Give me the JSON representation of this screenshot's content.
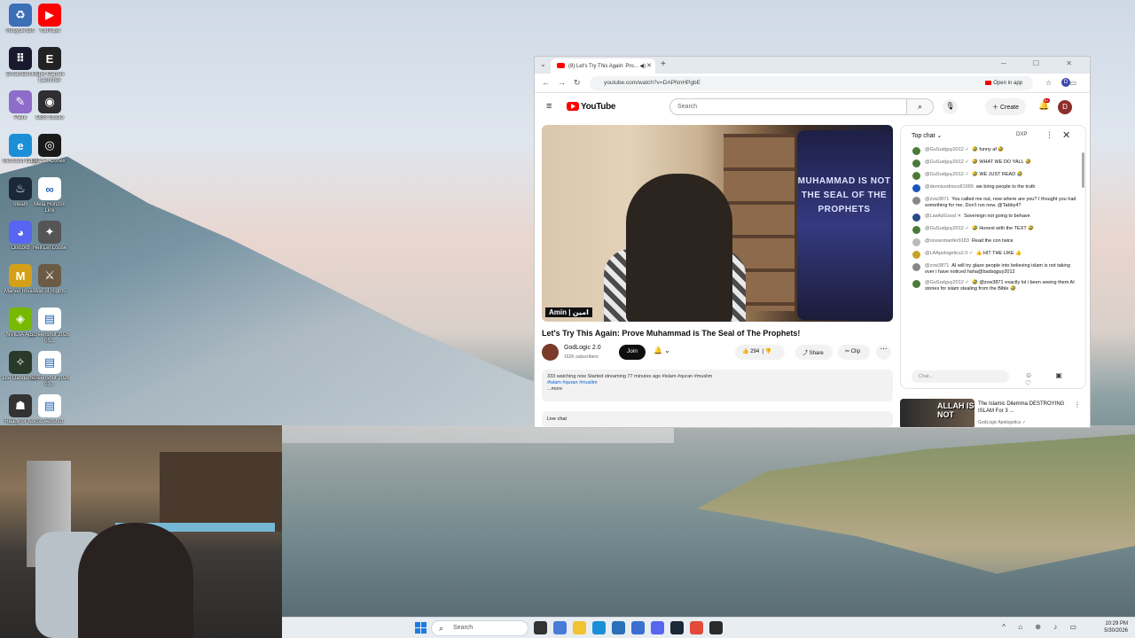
{
  "desktop": {
    "icons": [
      {
        "label": "Recycle Bin",
        "icon": "recycle-bin-icon",
        "color": "#3b6fb6",
        "glyph": "♻"
      },
      {
        "label": "YouTube",
        "icon": "youtube-icon",
        "color": "#ff0000",
        "glyph": "▶"
      },
      {
        "label": "DreamDeck",
        "icon": "dreamdeck-icon",
        "color": "#1a1a2e",
        "glyph": "⠿"
      },
      {
        "label": "Epic Games Launcher",
        "icon": "epic-games-icon",
        "color": "#222222",
        "glyph": "E"
      },
      {
        "label": "Paint",
        "icon": "paint-icon",
        "color": "#8e6cc9",
        "glyph": "✎"
      },
      {
        "label": "OBS Studio",
        "icon": "obs-icon",
        "color": "#302e31",
        "glyph": "◉"
      },
      {
        "label": "Microsoft Edge",
        "icon": "edge-icon",
        "color": "#1a8fd8",
        "glyph": "e"
      },
      {
        "label": "Razer Cortex",
        "icon": "razer-icon",
        "color": "#1a1a1a",
        "glyph": "◎"
      },
      {
        "label": "Steam",
        "icon": "steam-icon",
        "color": "#1b2838",
        "glyph": "♨"
      },
      {
        "label": "Meta Horizon Link",
        "icon": "meta-icon",
        "color": "#ffffff",
        "glyph": "∞"
      },
      {
        "label": "Discord",
        "icon": "discord-icon",
        "color": "#5865f2",
        "glyph": "◕"
      },
      {
        "label": "Hell Let Loose",
        "icon": "hell-let-loose-icon",
        "color": "#555555",
        "glyph": "✦"
      },
      {
        "label": "Marvel Rivals",
        "icon": "marvel-rivals-icon",
        "color": "#d4a017",
        "glyph": "M"
      },
      {
        "label": "War of Rights",
        "icon": "war-of-rights-icon",
        "color": "#6b5b45",
        "glyph": "⚔"
      },
      {
        "label": "NVIDIA App",
        "icon": "nvidia-icon",
        "color": "#76b900",
        "glyph": "◈"
      },
      {
        "label": "Screenshot 2026 05...",
        "icon": "screenshot-file-icon",
        "color": "#ffffff",
        "glyph": "▤"
      },
      {
        "label": "Lite Dangerous",
        "icon": "lite-dangerous-icon",
        "color": "#2a3a2a",
        "glyph": "✧"
      },
      {
        "label": "Screenshot 2026 03...",
        "icon": "screenshot-file-icon",
        "color": "#ffffff",
        "glyph": "▤"
      },
      {
        "label": "Ready or Not",
        "icon": "ready-or-not-icon",
        "color": "#333333",
        "glyph": "☗"
      },
      {
        "label": "Screenshot",
        "icon": "screenshot-file-icon",
        "color": "#ffffff",
        "glyph": "▤"
      }
    ]
  },
  "taskbar": {
    "search_placeholder": "Search",
    "apps": [
      {
        "name": "task-view",
        "color": "#333333"
      },
      {
        "name": "copilot",
        "color": "#4a7bd8"
      },
      {
        "name": "file-explorer",
        "color": "#f2c230"
      },
      {
        "name": "edge",
        "color": "#1a8fd8"
      },
      {
        "name": "store",
        "color": "#2a6fb8"
      },
      {
        "name": "draw",
        "color": "#3a6fd0"
      },
      {
        "name": "discord",
        "color": "#5865f2"
      },
      {
        "name": "steam",
        "color": "#1b2838"
      },
      {
        "name": "chrome",
        "color": "#e24a3a"
      },
      {
        "name": "razer",
        "color": "#2a2a2a"
      }
    ],
    "tray": "^ ⌂ ⊕ ♪ ▭",
    "time": "10:29 PM",
    "date": "5/30/2026"
  },
  "browser": {
    "tab_title": "(8) Let's Try This Again: Pro... ◀)",
    "url": "youtube.com/watch?v=DAPNnHPgbE",
    "open_in_app": "Open in app",
    "profile_initial": "D"
  },
  "youtube": {
    "logo_text": "YouTube",
    "search_placeholder": "Search",
    "create_label": "Create",
    "notification_count": "9+",
    "avatar_initial": "D",
    "video": {
      "overlay_text": "MUHAMMAD IS NOT THE SEAL OF THE PROPHETS",
      "caption": "Amin | امين",
      "title": "Let's Try This Again: Prove Muhammad is The Seal of The Prophets!"
    },
    "channel": {
      "name": "GodLogic 2.0",
      "subscribers": "162K subscribers",
      "join_label": "Join"
    },
    "actions": {
      "likes": "294",
      "share": "Share",
      "clip": "Clip"
    },
    "description": {
      "line1": "333 watching now  Started streaming 77 minutes ago",
      "line1_tags": "#islam #quran #muslim",
      "line2_tags": "#islam #quran #muslim",
      "more": "...more"
    },
    "live_chat_label": "Live chat",
    "chat": {
      "header": "Top chat",
      "header_badge": "DXP",
      "input_placeholder": "Chat...",
      "messages": [
        {
          "author": "@GuSudguy2012 ✓",
          "text": "🤣 funny af 🤣",
          "color": "#4a7a3a"
        },
        {
          "author": "@GuSudguy2012 ✓",
          "text": "🤣 WHAT WE DO YALL 🤣",
          "color": "#4a7a3a"
        },
        {
          "author": "@GuSudguy2012 ✓",
          "text": "🤣 WE JUST READ 🤣",
          "color": "#4a7a3a"
        },
        {
          "author": "@dennisodrisco81989",
          "text": "we bring people to the truth",
          "color": "#1a56b8"
        },
        {
          "author": "@zvw3871",
          "text": "You called me out, now where are you? I thought you had something for me. Don't run now. @Tabby4?",
          "color": "#888888"
        },
        {
          "author": "@LawfulGood ✕",
          "text": "Sovereign not going to behave",
          "color": "#2a4a8a"
        },
        {
          "author": "@GuSudguy2012 ✓",
          "text": "🤣 Honest with the TEXT 🤣",
          "color": "#4a7a3a"
        },
        {
          "author": "@oceanmanfer9183",
          "text": "Read the con twice",
          "color": "#bbbbbb"
        },
        {
          "author": "@LAApologetics2.0 ✓",
          "text": "👍 HIT THE LIKE 👍",
          "color": "#c9a227"
        },
        {
          "author": "@zvw3871",
          "text": "AI will try glaze people into believing islam is not taking over i have noticed haha@badsqguy2012",
          "color": "#888888"
        },
        {
          "author": "@GuSudguy2012 ✓",
          "text": "🤣 @zvw3871 exactly lol i been seeing them AI stories for islam stealing from the Bible 🤣",
          "color": "#4a7a3a"
        }
      ]
    },
    "recommendation": {
      "thumb_text": "ALLAH IS NOT",
      "title": "The Islamic Dilemma DESTROYING ISLAM For 3 ...",
      "channel": "GodLogic Apologetics ✓"
    }
  }
}
